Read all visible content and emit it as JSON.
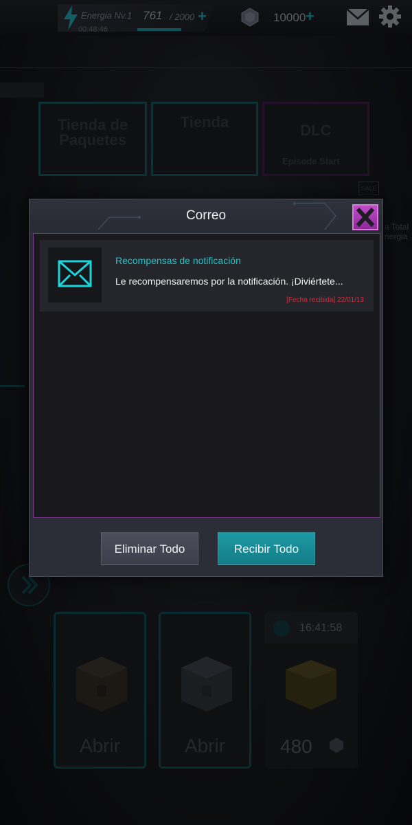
{
  "topbar": {
    "energy_label": "Energia Nv.1",
    "energy_value": "761",
    "energy_max": "/ 2000",
    "energy_timer": "00:48:46",
    "currency_value": "10000",
    "plus": "+"
  },
  "background": {
    "shop_cards": [
      {
        "title": "Tienda de Paquetes"
      },
      {
        "title": "Tienda"
      },
      {
        "title": "DLC",
        "subtitle": "Episode Start"
      }
    ],
    "sale_tag": "SALE",
    "side_text_1": "a Total",
    "side_text_2": "nergia",
    "cards": [
      {
        "label": "Abrir"
      },
      {
        "label": "Abrir"
      },
      {
        "timer": "16:41:58",
        "cost": "480"
      }
    ]
  },
  "dialog": {
    "title": "Correo",
    "mails": [
      {
        "title": "Recompensas de notificación",
        "body": "Le recompensaremos por la notificación. ¡Diviértete...",
        "date": "[Fecha recibida] 22/01/13"
      }
    ],
    "delete_all_label": "Eliminar Todo",
    "receive_all_label": "Recibir Todo"
  },
  "colors": {
    "accent": "#1fc4c8",
    "close_button": "#b040c0",
    "date_text": "#d8283a",
    "receive_button": "#178c96"
  },
  "icons": {
    "energy": "lightning-icon",
    "currency": "gem-icon",
    "mail": "envelope-icon",
    "settings": "gear-icon",
    "close": "close-icon",
    "mail_item": "envelope-icon",
    "timer": "hourglass-icon",
    "nav": "double-chevron-right-icon"
  }
}
